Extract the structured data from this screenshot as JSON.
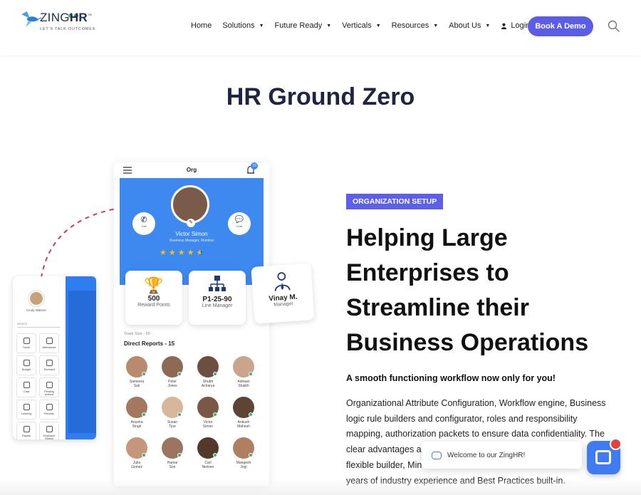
{
  "logo": {
    "zing": "ZING",
    "hr": "HR",
    "tm": "™",
    "tagline": "LET'S TALK OUTCOMES"
  },
  "nav": {
    "items": [
      {
        "label": "Home",
        "dropdown": false
      },
      {
        "label": "Solutions",
        "dropdown": true
      },
      {
        "label": "Future Ready",
        "dropdown": true
      },
      {
        "label": "Verticals",
        "dropdown": true
      },
      {
        "label": "Resources",
        "dropdown": true
      },
      {
        "label": "About Us",
        "dropdown": true
      }
    ],
    "login": "Login",
    "cta": "Book A Demo"
  },
  "page_title": "HR Ground Zero",
  "section": {
    "tag": "ORGANIZATION SETUP",
    "heading_lines": [
      "Helping Large",
      "Enterprises to",
      "Streamline their",
      "Business Operations"
    ],
    "subheading": "A smooth functioning workflow now only for you!",
    "paragraph": "Organizational Attribute Configuration, Workflow engine, Business logic rule builders and configurator, roles and responsibility mapping, authorization packets to ensure data confidentiality. The clear advantages are... flexible builder, Min... years of industry experience and Best Practices built-in.",
    "para_lines": [
      "Organizational Attribute Configuration, Workflow engine, Business",
      "logic rule builders and configurator, roles and responsibility",
      "mapping, authorization packets to ensure data confidentiality. The",
      "clear advantages a",
      "flexible builder, Min",
      "years of industry experience and Best Practices built-in."
    ]
  },
  "phone": {
    "header": "Org",
    "badge": "23",
    "profile_name": "Victor Simon",
    "profile_role": "Business Manager, Mumbai",
    "call": "Call",
    "chat": "Chat",
    "rating": 4.5,
    "cards": [
      {
        "value": "500",
        "label": "Reward Points"
      },
      {
        "value": "P1-25-90",
        "label": "Line Manager"
      },
      {
        "value": "Vinay M.",
        "label": "Manager"
      }
    ],
    "team_size": "Team Size - 50",
    "direct_reports": "Direct Reports - 15",
    "reports": [
      [
        "Sameera",
        "Sali"
      ],
      [
        "Peter",
        "Jones"
      ],
      [
        "Shubh",
        "Acharya"
      ],
      [
        "Adnaan",
        "Shaikh"
      ],
      [
        "Anusha",
        "Singh"
      ],
      [
        "Susan",
        "Tjoe"
      ],
      [
        "Victor",
        "Simon"
      ],
      [
        "Ankush",
        "Mahesh"
      ],
      [
        "Julia",
        "Gomez"
      ],
      [
        "Hamai",
        "Son"
      ],
      [
        "Carl",
        "Nielsen"
      ],
      [
        "Mangesh",
        "Jogi"
      ]
    ]
  },
  "side_phone": {
    "user": "Cindy Watson",
    "search": "Search",
    "tiles": [
      "Travel",
      "Attendance",
      "Budget",
      "Timecard",
      "Chat",
      "Pending Actions",
      "Learning",
      "Recruits",
      "Payslip",
      "Employee Search"
    ]
  },
  "chat": {
    "welcome": "Welcome to our ZingHR!"
  },
  "colors": {
    "accent": "#5b5de6",
    "app_blue": "#3d89f0",
    "heading": "#1f2440",
    "chat_button": "#3f7cf4"
  }
}
